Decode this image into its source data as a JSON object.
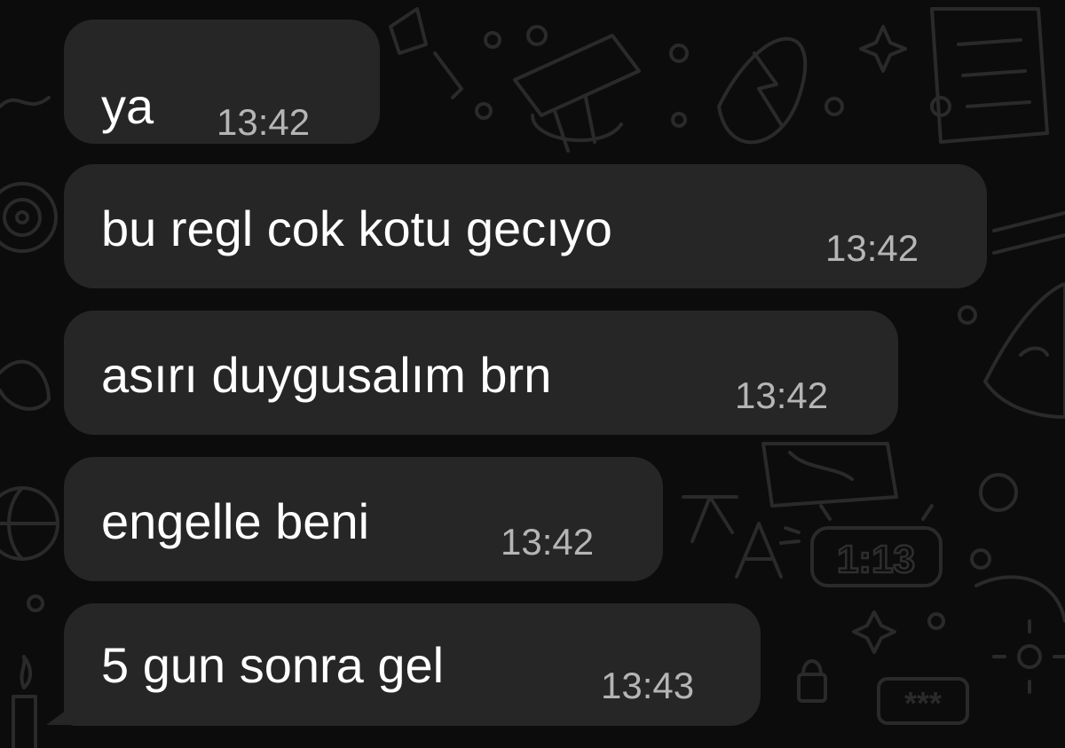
{
  "conversation": {
    "messages": [
      {
        "text": "ya",
        "time": "13:42"
      },
      {
        "text": "bu regl cok kotu gecıyo",
        "time": "13:42"
      },
      {
        "text": "asırı duygusalım brn",
        "time": "13:42"
      },
      {
        "text": "engelle beni",
        "time": "13:42"
      },
      {
        "text": "5 gun sonra gel",
        "time": "13:43"
      }
    ]
  },
  "wallpaper": {
    "clock_doodle_text": "1:13",
    "password_doodle_text": "***",
    "translate_doodle_text": "文A"
  },
  "colors": {
    "background": "#0c0c0c",
    "bubble": "#262626",
    "message_text": "#ffffff",
    "timestamp": "#b5b5b5",
    "doodle_stroke": "#2a2a2a"
  }
}
